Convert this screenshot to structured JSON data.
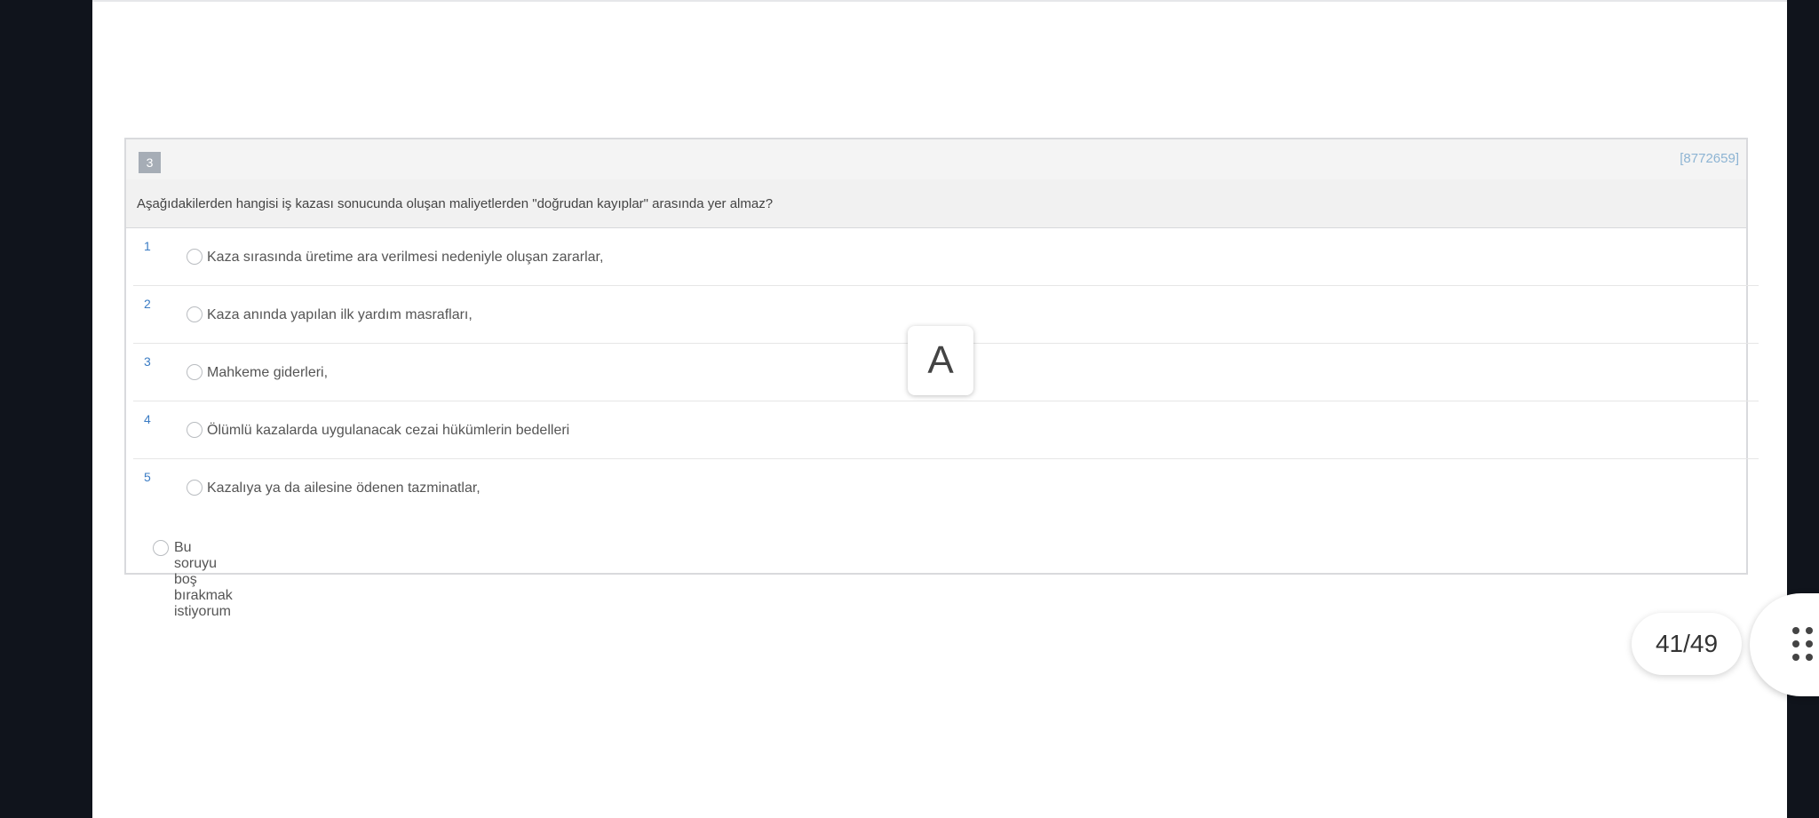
{
  "question": {
    "number": "3",
    "id": "[8772659]",
    "text": "Aşağıdakilerden hangisi iş kazası sonucunda oluşan maliyetlerden \"doğrudan kayıplar\" arasında yer almaz?",
    "options": [
      {
        "num": "1",
        "text": "Kaza sırasında üretime ara verilmesi nedeniyle oluşan zararlar,"
      },
      {
        "num": "2",
        "text": "Kaza anında yapılan ilk yardım masrafları,"
      },
      {
        "num": "3",
        "text": "Mahkeme giderleri,"
      },
      {
        "num": "4",
        "text": "Ölümlü kazalarda uygulanacak cezai hükümlerin bedelleri"
      },
      {
        "num": "5",
        "text": "Kazalıya ya da ailesine ödenen tazminatlar,"
      }
    ],
    "skip_label": "Bu soruyu boş bırakmak istiyorum"
  },
  "answer_badge": "A",
  "pagination": {
    "label": "41/49"
  },
  "icons": {
    "grid": "grid-dots-icon"
  }
}
